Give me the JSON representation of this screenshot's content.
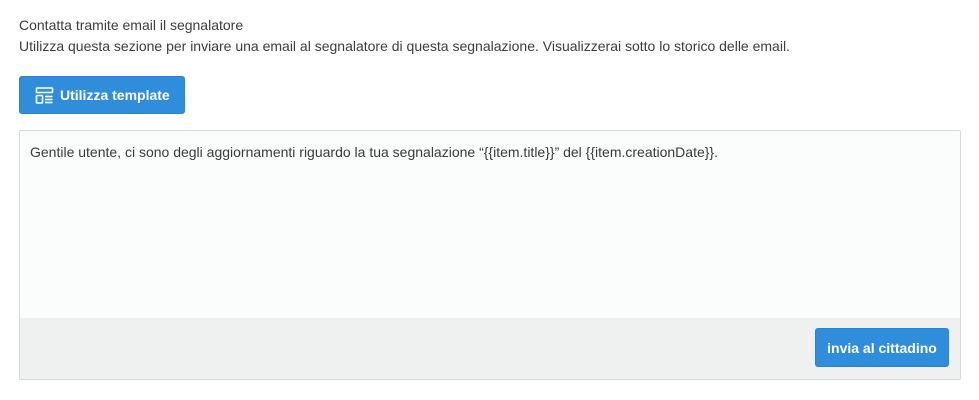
{
  "section": {
    "title": "Contatta tramite email il segnalatore",
    "description": "Utilizza questa sezione per inviare una email al segnalatore di questa segnalazione. Visualizzerai sotto lo storico delle email."
  },
  "toolbar": {
    "template_label": "Utilizza template",
    "template_icon": "template-layout-icon"
  },
  "editor": {
    "content": "Gentile utente, ci sono degli aggiornamenti riguardo la tua segnalazione “{{item.title}}” del {{item.creationDate}}."
  },
  "footer": {
    "send_label": "invia al cittadino"
  },
  "colors": {
    "accent": "#2f8ddb",
    "footer_bg": "#eff0f0",
    "editor_bg": "#fbfcfc"
  }
}
